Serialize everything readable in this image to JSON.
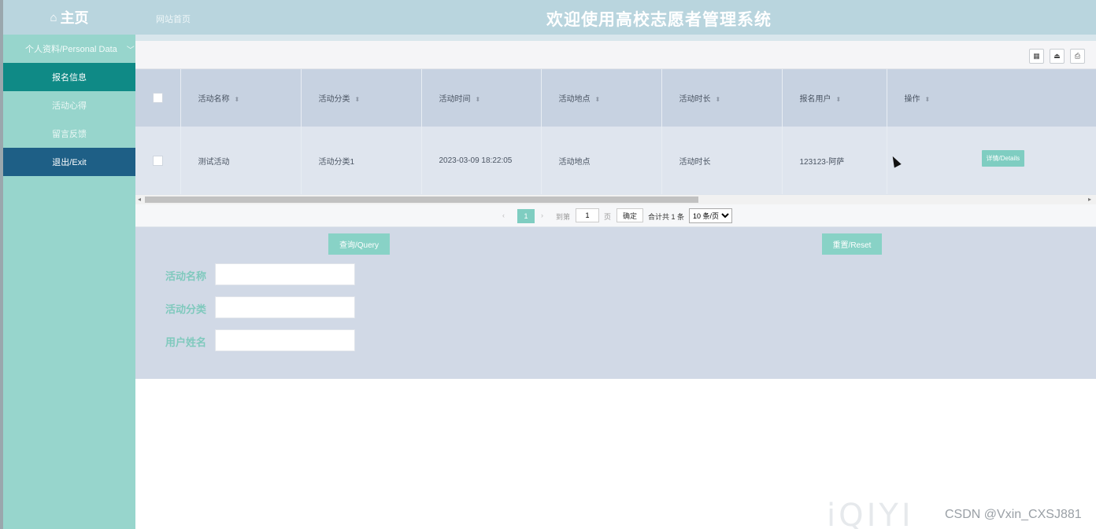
{
  "header": {
    "home_label": "主页",
    "home_icon": "home-icon",
    "site_link": "网站首页",
    "welcome": "欢迎使用高校志愿者管理系统"
  },
  "sidebar": {
    "group_label": "个人资料/Personal Data",
    "group_icon": "chevron-down-icon",
    "items": [
      {
        "label": "报名信息",
        "active": true
      },
      {
        "label": "活动心得",
        "active": false
      },
      {
        "label": "留言反馈",
        "active": false
      },
      {
        "label": "退出/Exit",
        "active": false
      }
    ]
  },
  "toolbar": {
    "icons": [
      "columns-icon",
      "export-icon",
      "print-icon"
    ]
  },
  "table": {
    "columns": [
      "活动名称",
      "活动分类",
      "活动时间",
      "活动地点",
      "活动时长",
      "报名用户",
      "操作"
    ],
    "rows": [
      {
        "name": "测试活动",
        "category": "活动分类1",
        "time": "2023-03-09 18:22:05",
        "location": "活动地点",
        "duration": "活动时长",
        "user": "123123-阿萨",
        "action": "详情/Details"
      }
    ]
  },
  "pager": {
    "current_page": "1",
    "goto_label": "到第",
    "goto_value": "1",
    "page_unit": "页",
    "confirm": "确定",
    "total": "合计共 1 条",
    "page_size": "10 条/页"
  },
  "search": {
    "query_button": "查询/Query",
    "reset_button": "重置/Reset",
    "fields": [
      {
        "label": "活动名称",
        "value": ""
      },
      {
        "label": "活动分类",
        "value": ""
      },
      {
        "label": "用户姓名",
        "value": ""
      }
    ]
  },
  "watermark": {
    "logo": "iQIYI",
    "csdn": "CSDN @Vxin_CXSJ881"
  },
  "colors": {
    "header_bg": "#b9d5de",
    "sidebar_bg": "#97d5cc",
    "active_item": "#0f8a86",
    "exit_item": "#1e5f86",
    "accent_button": "#88d2c6",
    "label_text": "#7fc9bd"
  }
}
